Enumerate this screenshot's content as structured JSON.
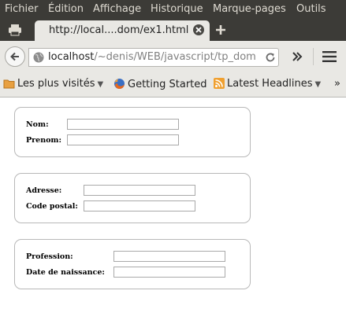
{
  "menu": {
    "items": [
      "Fichier",
      "Édition",
      "Affichage",
      "Historique",
      "Marque-pages",
      "Outils"
    ]
  },
  "tab": {
    "title": "http://local....dom/ex1.html"
  },
  "navbar": {
    "url_host": "localhost",
    "url_path": "/~denis/WEB/javascript/tp_dom"
  },
  "bookmarks": {
    "items": [
      "Les plus visités",
      "Getting Started",
      "Latest Headlines"
    ],
    "more": "»"
  },
  "form": {
    "group1": {
      "label1": "Nom:",
      "label2": "Prenom:",
      "value1": "",
      "value2": ""
    },
    "group2": {
      "label1": "Adresse:",
      "label2": "Code postal:",
      "value1": "",
      "value2": ""
    },
    "group3": {
      "label1": "Profession:",
      "label2": "Date de naissance:",
      "value1": "",
      "value2": ""
    }
  },
  "colors": {
    "chrome_dark": "#3c3b37",
    "toolbar": "#e9e8e4",
    "menu_text": "#dfdbd2",
    "rss_orange": "#f0a030"
  }
}
